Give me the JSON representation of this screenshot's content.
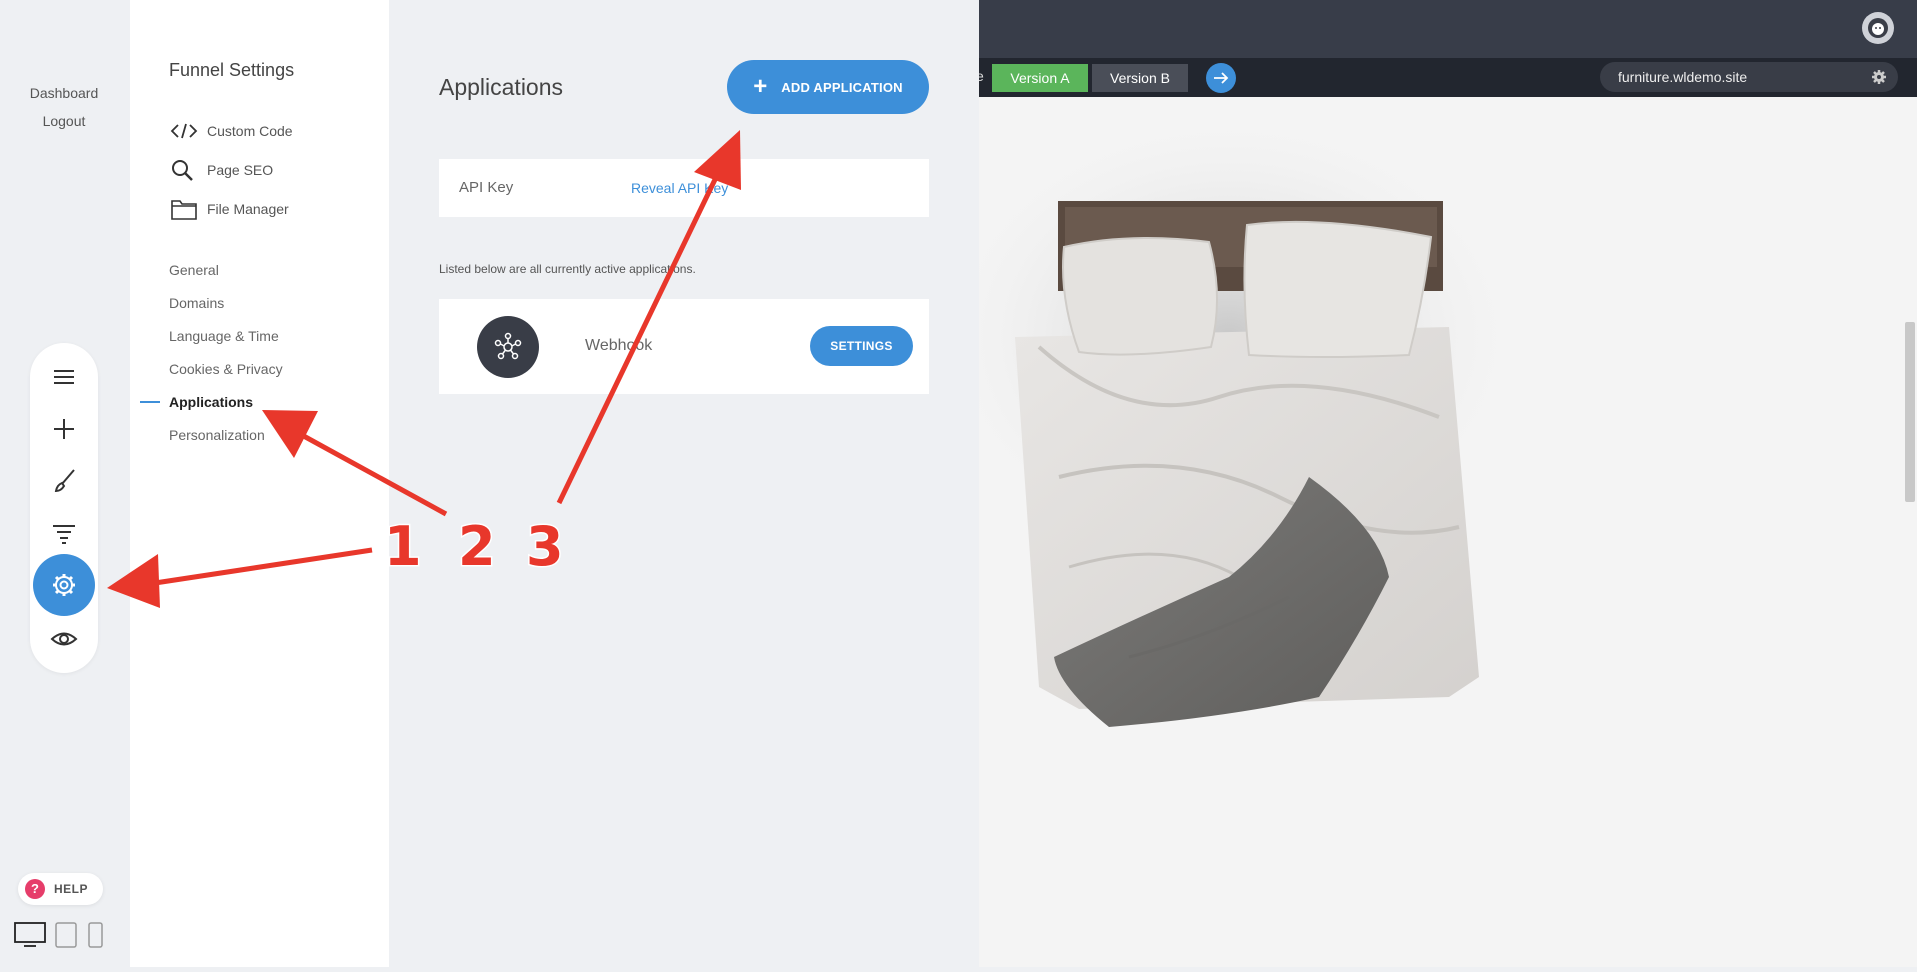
{
  "left_rail": {
    "links": [
      "Dashboard",
      "Logout"
    ],
    "tools": [
      "menu-icon",
      "plus-icon",
      "brush-icon",
      "filter-icon",
      "gear-icon",
      "eye-icon"
    ],
    "help_label": "HELP"
  },
  "settings_nav": {
    "title": "Funnel Settings",
    "tools": [
      {
        "icon": "code-icon",
        "label": "Custom Code"
      },
      {
        "icon": "search-icon",
        "label": "Page SEO"
      },
      {
        "icon": "folder-icon",
        "label": "File Manager"
      }
    ],
    "items": [
      {
        "label": "General",
        "active": false
      },
      {
        "label": "Domains",
        "active": false
      },
      {
        "label": "Language & Time",
        "active": false
      },
      {
        "label": "Cookies & Privacy",
        "active": false
      },
      {
        "label": "Applications",
        "active": true
      },
      {
        "label": "Personalization",
        "active": false
      }
    ]
  },
  "content": {
    "title": "Applications",
    "add_button_label": "ADD APPLICATION",
    "api_key_label": "API Key",
    "api_reveal_label": "Reveal API Key",
    "listed_text": "Listed below are all currently active applications.",
    "applications": [
      {
        "name": "Webhook",
        "icon": "webhook-icon",
        "button": "SETTINGS"
      }
    ]
  },
  "toolbar": {
    "partial_text": "e",
    "version_a": "Version A",
    "version_b": "Version B",
    "url": "furniture.wldemo.site"
  },
  "annotations": {
    "numbers": [
      "1",
      "2",
      "3"
    ]
  },
  "colors": {
    "accent": "#3d8fd9",
    "version_a": "#5bb55b",
    "help": "#e63d6a",
    "annotation": "#e8372b"
  }
}
